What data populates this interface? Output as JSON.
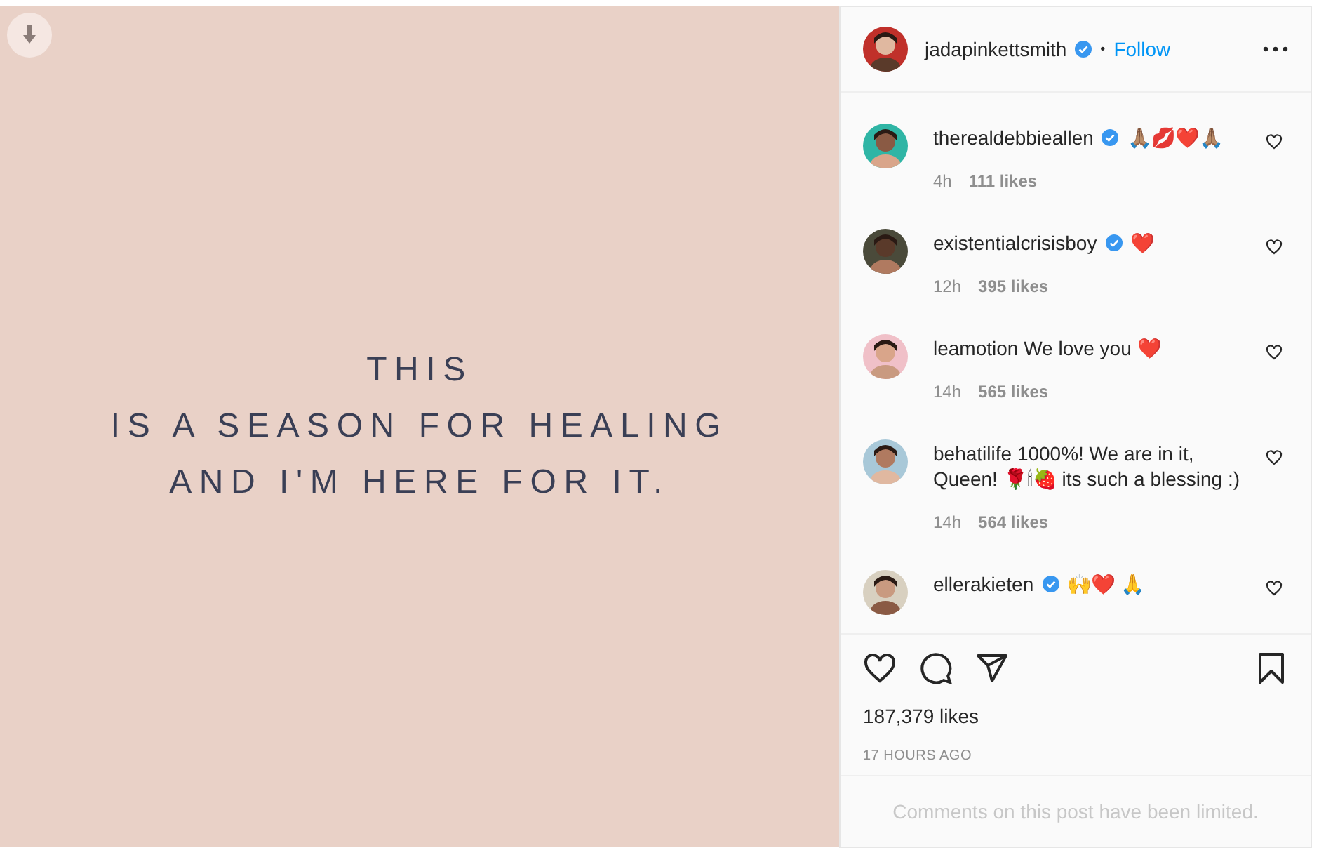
{
  "post": {
    "lines": [
      "THIS",
      "IS A SEASON FOR HEALING",
      "AND I'M HERE FOR IT."
    ]
  },
  "header": {
    "username": "jadapinkettsmith",
    "verified": true,
    "separator": "•",
    "follow": "Follow"
  },
  "comments": [
    {
      "username": "therealdebbieallen",
      "verified": true,
      "text": "🙏🏽💋❤️🙏🏽",
      "time": "4h",
      "likes": "111 likes"
    },
    {
      "username": "existentialcrisisboy",
      "verified": true,
      "text": "❤️",
      "time": "12h",
      "likes": "395 likes"
    },
    {
      "username": "leamotion",
      "verified": false,
      "text": "We love you ❤️",
      "time": "14h",
      "likes": "565 likes"
    },
    {
      "username": "behatilife",
      "verified": false,
      "text": "1000%! We are in it, Queen! 🌹🕯🍓 its such a blessing :)",
      "time": "14h",
      "likes": "564 likes"
    },
    {
      "username": "ellerakieten",
      "verified": true,
      "text": "🙌❤️ 🙏"
    }
  ],
  "likes": "187,379 likes",
  "posted": "17 HOURS AGO",
  "footer": "Comments on this post have been limited."
}
